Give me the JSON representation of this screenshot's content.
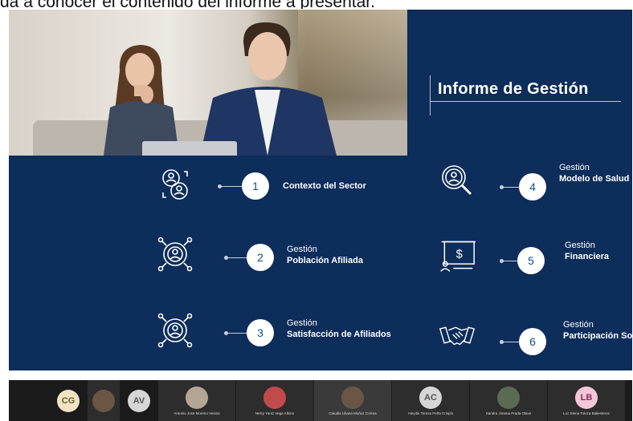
{
  "caption": "da a conocer el contenido del informe a presentar.",
  "slide": {
    "title": "Informe de Gestión",
    "items": [
      {
        "num": "1",
        "sub": "",
        "main": "Contexto del Sector",
        "icon": "people-cycle-icon"
      },
      {
        "num": "2",
        "sub": "Gestión",
        "main": "Población Afiliada",
        "icon": "target-person-icon"
      },
      {
        "num": "3",
        "sub": "Gestión",
        "main": "Satisfacción de Afiliados",
        "icon": "target-person-icon"
      },
      {
        "num": "4",
        "sub": "Gestión",
        "main": "Modelo de Salud",
        "icon": "magnifier-person-icon"
      },
      {
        "num": "5",
        "sub": "Gestión",
        "main": "Financiera",
        "icon": "presentation-dollar-icon"
      },
      {
        "num": "6",
        "sub": "Gestión",
        "main": "Participación Social",
        "icon": "handshake-icon"
      }
    ]
  },
  "participants": [
    {
      "initials": "CG",
      "name": "",
      "color": "#efe4c2",
      "text": "#6b5a2a"
    },
    {
      "initials": "",
      "name": "",
      "color": "#6b5545",
      "text": "#fff"
    },
    {
      "initials": "AV",
      "name": "",
      "color": "#d6d6d6",
      "text": "#555"
    },
    {
      "initials": "",
      "name": "Antonio Jose Moreno Vesina",
      "color": "#b5a596",
      "text": "#fff"
    },
    {
      "initials": "",
      "name": "Nelcy Yaniz Vega Albino",
      "color": "#c14a4a",
      "text": "#fff"
    },
    {
      "initials": "",
      "name": "Claudia Liliana Muñoz Correa",
      "color": "#6b5545",
      "text": "#fff"
    },
    {
      "initials": "AC",
      "name": "Aleydis Teresa Peña Crispín",
      "color": "#d6d6d6",
      "text": "#555"
    },
    {
      "initials": "",
      "name": "Sandra Jimena Prada Olave",
      "color": "#5a6b52",
      "text": "#fff"
    },
    {
      "initials": "LB",
      "name": "Luz Elena Toloza Ballesteros",
      "color": "#f3c6d8",
      "text": "#8a2f5a"
    }
  ]
}
